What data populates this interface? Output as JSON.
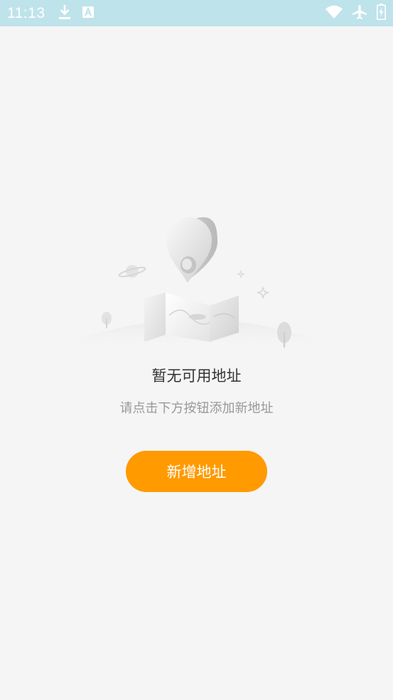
{
  "status_bar": {
    "time": "11:13",
    "left_icons": [
      "download-icon",
      "a-badge-icon"
    ],
    "right_icons": [
      "wifi-icon",
      "airplane-icon",
      "battery-charging-icon"
    ],
    "background": "#bfe3ea"
  },
  "empty_state": {
    "illustration": "map-location-pin-illustration",
    "title": "暂无可用地址",
    "hint": "请点击下方按钮添加新地址"
  },
  "actions": {
    "add_address_label": "新增地址",
    "button_color": "#ff9a00"
  }
}
